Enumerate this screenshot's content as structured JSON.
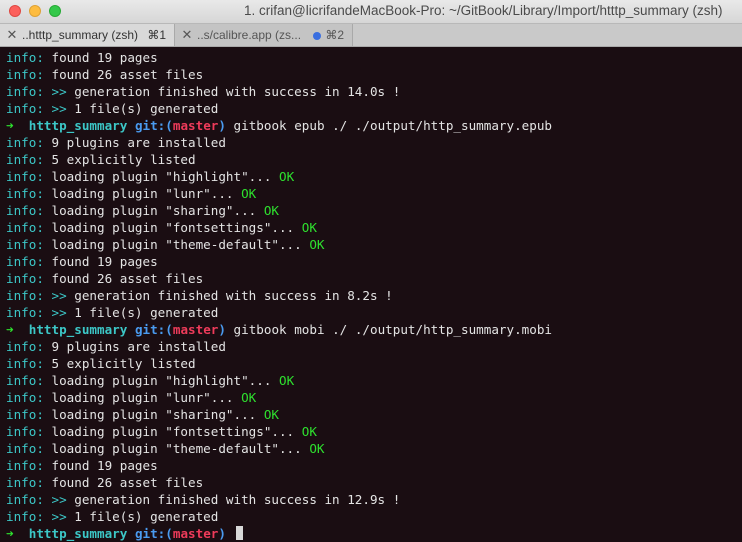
{
  "window": {
    "title": "1. crifan@licrifandeMacBook-Pro: ~/GitBook/Library/Import/htttp_summary (zsh)",
    "tabs": [
      {
        "close": "✕",
        "label": "..htttp_summary (zsh)",
        "shortcut": "⌘1"
      },
      {
        "close": "✕",
        "label": "..s/calibre.app (zs...",
        "shortcut": "⌘2"
      }
    ]
  },
  "colors": {
    "background": "#1a0d12",
    "info": "#3cc7c7",
    "ok": "#2ee02e",
    "branch": "#ee3b5a",
    "git": "#4a9bf0"
  },
  "prompt": {
    "arrow": "➜",
    "dir": "htttp_summary",
    "git": "git:(",
    "branch": "master",
    "close": ")"
  },
  "terminal": {
    "lines": [
      {
        "type": "info",
        "text": "found 19 pages"
      },
      {
        "type": "info",
        "text": "found 26 asset files"
      },
      {
        "type": "info",
        "text": ">> generation finished with success in 14.0s !"
      },
      {
        "type": "info",
        "text": ">> 1 file(s) generated"
      },
      {
        "type": "prompt",
        "cmd": " gitbook epub ./ ./output/http_summary.epub"
      },
      {
        "type": "info",
        "text": "9 plugins are installed"
      },
      {
        "type": "info",
        "text": "5 explicitly listed"
      },
      {
        "type": "info",
        "text": "loading plugin \"highlight\"...",
        "ok": "OK"
      },
      {
        "type": "info",
        "text": "loading plugin \"lunr\"...",
        "ok": "OK"
      },
      {
        "type": "info",
        "text": "loading plugin \"sharing\"...",
        "ok": "OK"
      },
      {
        "type": "info",
        "text": "loading plugin \"fontsettings\"...",
        "ok": "OK"
      },
      {
        "type": "info",
        "text": "loading plugin \"theme-default\"...",
        "ok": "OK"
      },
      {
        "type": "info",
        "text": "found 19 pages"
      },
      {
        "type": "info",
        "text": "found 26 asset files"
      },
      {
        "type": "info",
        "text": ">> generation finished with success in 8.2s !"
      },
      {
        "type": "info",
        "text": ">> 1 file(s) generated"
      },
      {
        "type": "prompt",
        "cmd": " gitbook mobi ./ ./output/http_summary.mobi"
      },
      {
        "type": "info",
        "text": "9 plugins are installed"
      },
      {
        "type": "info",
        "text": "5 explicitly listed"
      },
      {
        "type": "info",
        "text": "loading plugin \"highlight\"...",
        "ok": "OK"
      },
      {
        "type": "info",
        "text": "loading plugin \"lunr\"...",
        "ok": "OK"
      },
      {
        "type": "info",
        "text": "loading plugin \"sharing\"...",
        "ok": "OK"
      },
      {
        "type": "info",
        "text": "loading plugin \"fontsettings\"...",
        "ok": "OK"
      },
      {
        "type": "info",
        "text": "loading plugin \"theme-default\"...",
        "ok": "OK"
      },
      {
        "type": "info",
        "text": "found 19 pages"
      },
      {
        "type": "info",
        "text": "found 26 asset files"
      },
      {
        "type": "info",
        "text": ">> generation finished with success in 12.9s !"
      },
      {
        "type": "info",
        "text": ">> 1 file(s) generated"
      },
      {
        "type": "prompt",
        "cmd": " ",
        "cursor": true
      }
    ],
    "info_prefix": "info:"
  }
}
